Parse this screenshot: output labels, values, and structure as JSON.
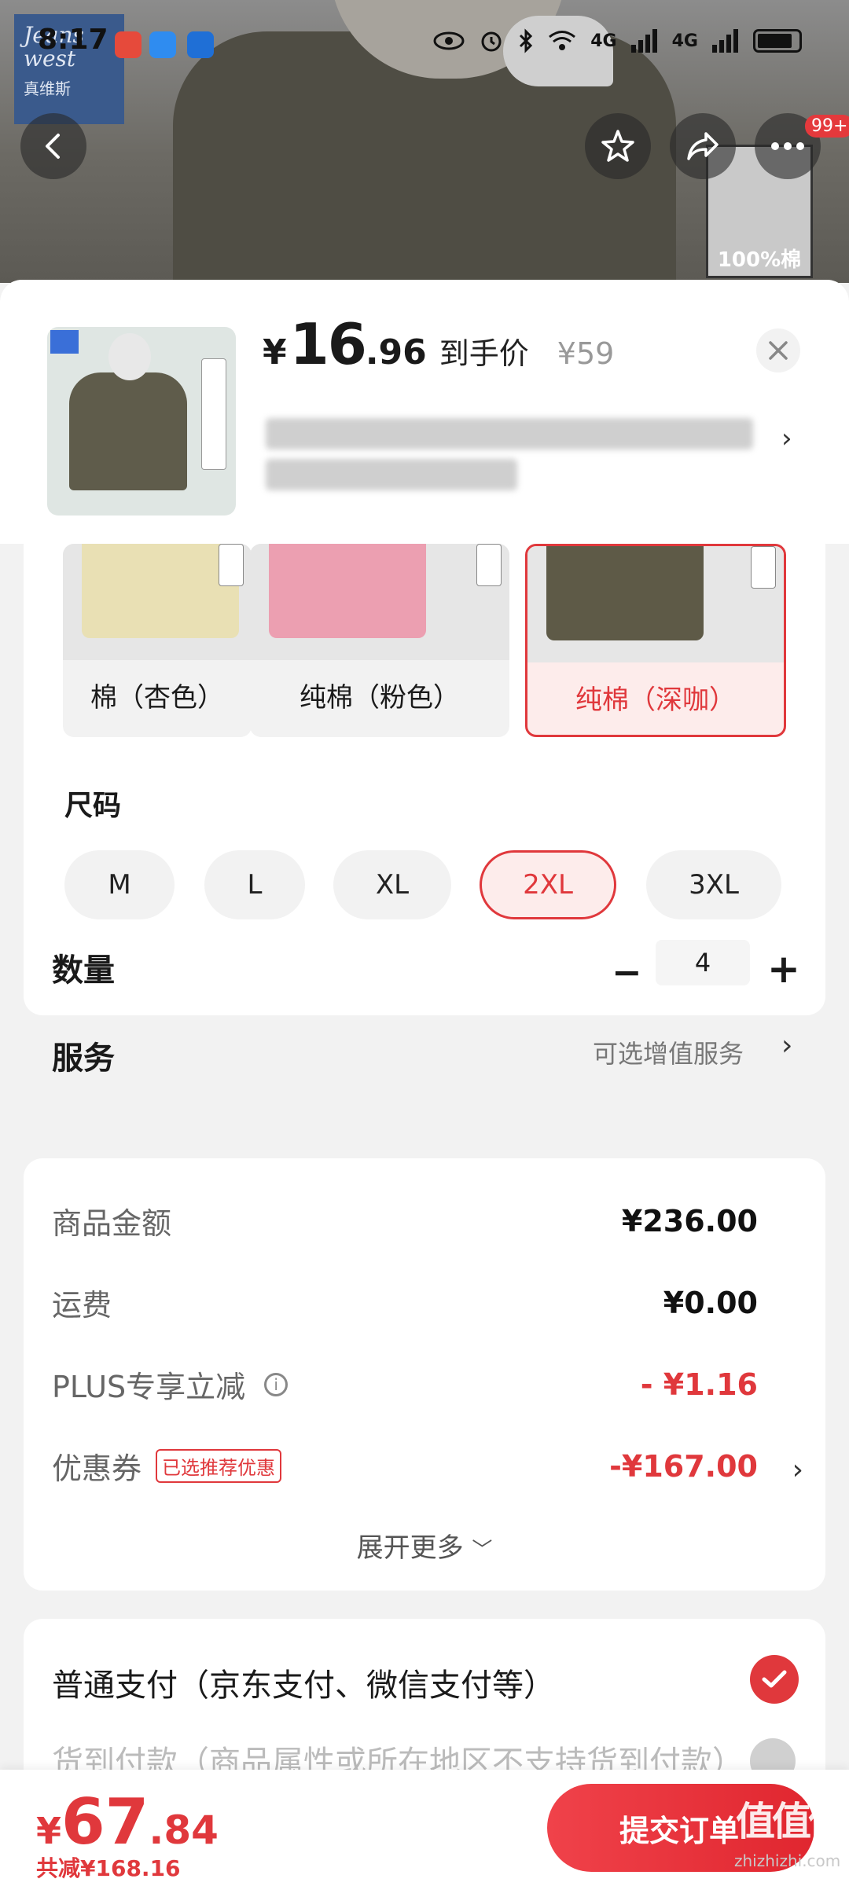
{
  "status_bar": {
    "time": "8:17",
    "signal_1": "4G",
    "signal_2": "4G"
  },
  "background": {
    "brand_logo_text": "Jeans west",
    "brand_logo_cn": "真维斯",
    "thumbnail_label": "100%棉",
    "notification_badge": "99+"
  },
  "header": {
    "currency": "¥",
    "price_int": "16",
    "price_dec": ".96",
    "price_label": "到手价",
    "original_price": "¥59"
  },
  "colors": {
    "options": [
      {
        "label": "棉（杏色）",
        "selected": false,
        "color": "#e9e0b4"
      },
      {
        "label": "纯棉（粉色）",
        "selected": false,
        "color": "#ec9fb1"
      },
      {
        "label": "纯棉（深咖）",
        "selected": true,
        "color": "#5e5a47"
      }
    ]
  },
  "size": {
    "title": "尺码",
    "options": [
      {
        "label": "M",
        "selected": false
      },
      {
        "label": "L",
        "selected": false
      },
      {
        "label": "XL",
        "selected": false
      },
      {
        "label": "2XL",
        "selected": true
      },
      {
        "label": "3XL",
        "selected": false
      }
    ]
  },
  "quantity": {
    "title": "数量",
    "value": "4",
    "minus": "−",
    "plus": "+"
  },
  "service": {
    "title": "服务",
    "value": "可选增值服务"
  },
  "price_detail": {
    "goods_amount_label": "商品金额",
    "goods_amount_value": "¥236.00",
    "shipping_label": "运费",
    "shipping_value": "¥0.00",
    "plus_label": "PLUS专享立减",
    "plus_value": "- ¥1.16",
    "coupon_label": "优惠券",
    "coupon_tag": "已选推荐优惠",
    "coupon_value": "-¥167.00",
    "expand_label": "展开更多"
  },
  "payment": {
    "normal_label": "普通支付（京东支付、微信支付等）",
    "cod_label": "货到付款（商品属性或所在地区不支持货到付款）"
  },
  "bottom_bar": {
    "currency": "¥",
    "total_int": "67",
    "total_dec": ".84",
    "saved_text": "共减¥168.16",
    "submit_label": "提交订单",
    "watermark": "值值值",
    "watermark_sub": "zhizhizhi.com"
  },
  "theme": {
    "accent": "#e0383c"
  }
}
